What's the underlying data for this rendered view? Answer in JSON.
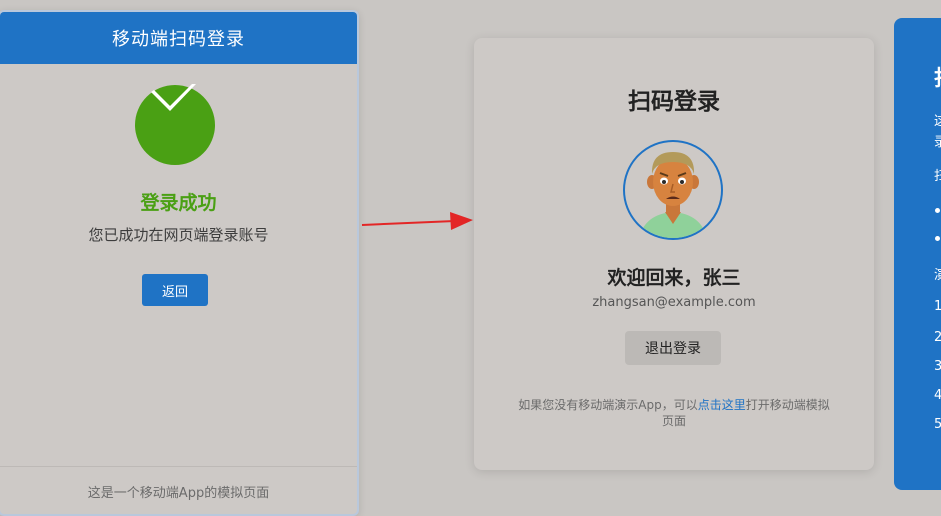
{
  "phone": {
    "header_title": "移动端扫码登录",
    "success_title": "登录成功",
    "success_message": "您已成功在网页端登录账号",
    "back_label": "返回",
    "footer_text": "这是一个移动端App的模拟页面"
  },
  "card": {
    "title": "扫码登录",
    "welcome": "欢迎回来，张三",
    "email": "zhangsan@example.com",
    "logout_label": "退出登录",
    "hint_before": "如果您没有移动端演示App，可以",
    "hint_link": "点击这里",
    "hint_after": "打开移动端模拟页面"
  },
  "side": {
    "title": "扫",
    "lines": [
      "这",
      "录",
      "扫",
      "演",
      "1",
      "2",
      "3",
      "4",
      "5"
    ]
  },
  "colors": {
    "accent": "#1f73c5",
    "success": "#4aa014",
    "arrow": "#e32626",
    "background": "#c9c6c3"
  },
  "icons": {
    "success": "checkmark-circle-icon",
    "arrow": "arrow-right-icon",
    "avatar": "user-avatar-icon"
  }
}
